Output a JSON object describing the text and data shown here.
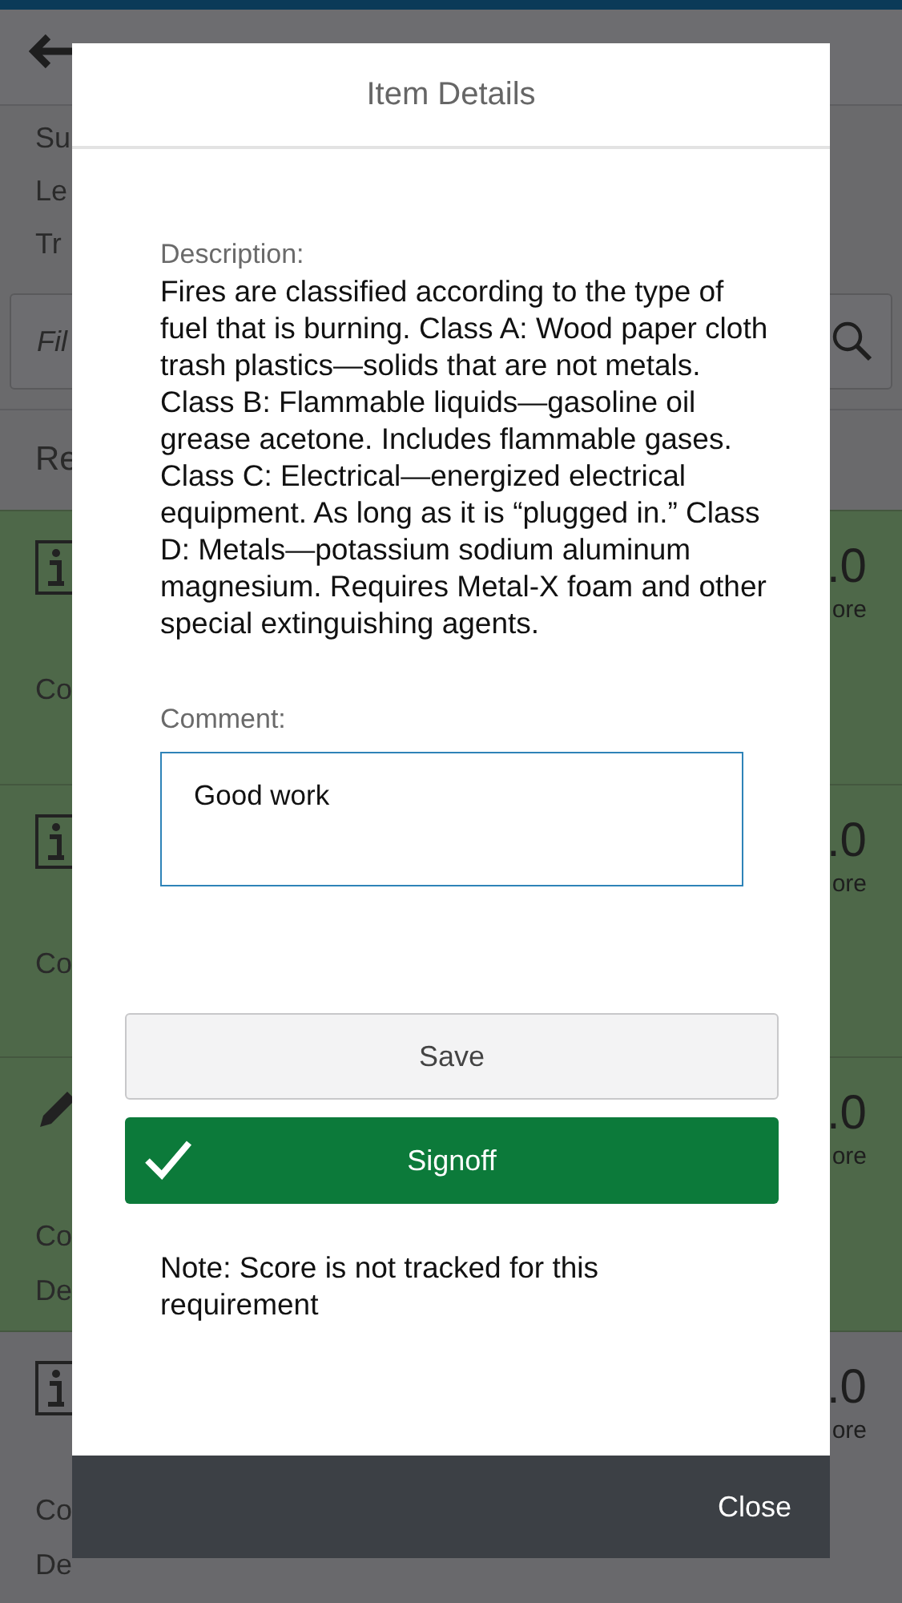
{
  "background": {
    "header_rows": [
      "Su",
      "Le",
      "Tr"
    ],
    "filter": {
      "placeholder": "Fil"
    },
    "section_title": "Re",
    "cards": [
      {
        "kind": "info",
        "completed": true,
        "lines": [
          "Co"
        ],
        "score": ".0",
        "score_label": "ore"
      },
      {
        "kind": "info",
        "completed": true,
        "lines": [
          "Co"
        ],
        "score": ".0",
        "score_label": "ore"
      },
      {
        "kind": "edit",
        "completed": true,
        "lines": [
          "Co",
          "De"
        ],
        "score": ".0",
        "score_label": "ore"
      },
      {
        "kind": "info",
        "completed": false,
        "lines": [
          "Co",
          "De"
        ],
        "score": ".0",
        "score_label": "ore"
      }
    ]
  },
  "modal": {
    "title": "Item Details",
    "description_label": "Description:",
    "description": "Fires are classified according to the type of fuel that is burning. Class A: Wood paper cloth trash plastics—solids that are not metals. Class B: Flammable liquids—gasoline oil grease acetone. Includes flammable gases. Class C: Electrical—energized electrical equipment. As long as it is “plugged in.” Class D: Metals—potassium sodium aluminum magnesium. Requires Metal-X foam and other special extinguishing agents.",
    "comment_label": "Comment:",
    "comment": "Good work",
    "buttons": [
      {
        "kind": "plain",
        "label": "Save"
      },
      {
        "kind": "primary",
        "label": "Signoff"
      }
    ],
    "note": "Note: Score is not tracked for this requirement",
    "footer_button": "Close"
  }
}
